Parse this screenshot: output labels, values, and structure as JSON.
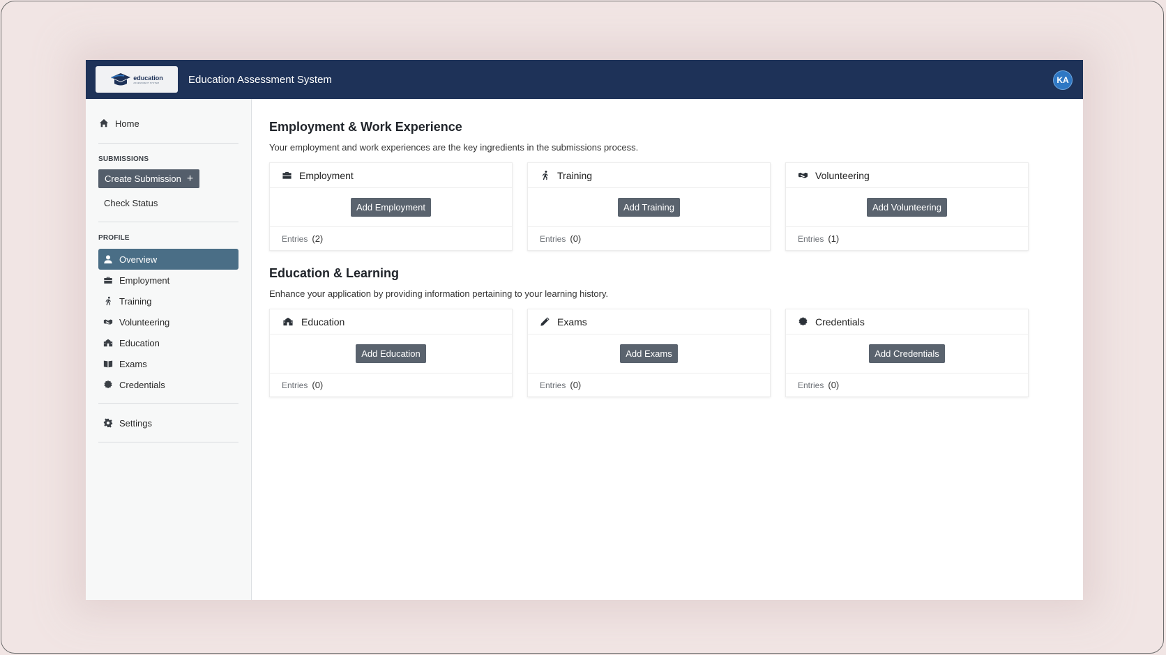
{
  "header": {
    "logo_word": "education",
    "logo_sub": "ASSESSMENT SYSTEM",
    "title": "Education Assessment System",
    "avatar_initials": "KA"
  },
  "sidebar": {
    "home": "Home",
    "submissions_label": "SUBMISSIONS",
    "create_submission": "Create Submission",
    "check_status": "Check Status",
    "profile_label": "PROFILE",
    "items": [
      {
        "label": "Overview",
        "icon": "user-icon"
      },
      {
        "label": "Employment",
        "icon": "briefcase-icon"
      },
      {
        "label": "Training",
        "icon": "running-icon"
      },
      {
        "label": "Volunteering",
        "icon": "handshake-icon"
      },
      {
        "label": "Education",
        "icon": "school-icon"
      },
      {
        "label": "Exams",
        "icon": "book-icon"
      },
      {
        "label": "Credentials",
        "icon": "badge-icon"
      }
    ],
    "settings": "Settings"
  },
  "sections": [
    {
      "title": "Employment & Work Experience",
      "description": "Your employment and work experiences are the key ingredients in the submissions process.",
      "cards": [
        {
          "title": "Employment",
          "button": "Add Employment",
          "entries_label": "Entries",
          "count": "(2)"
        },
        {
          "title": "Training",
          "button": "Add Training",
          "entries_label": "Entries",
          "count": "(0)"
        },
        {
          "title": "Volunteering",
          "button": "Add Volunteering",
          "entries_label": "Entries",
          "count": "(1)"
        }
      ]
    },
    {
      "title": "Education & Learning",
      "description": "Enhance your application by providing information pertaining to your learning history.",
      "cards": [
        {
          "title": "Education",
          "button": "Add Education",
          "entries_label": "Entries",
          "count": "(0)"
        },
        {
          "title": "Exams",
          "button": "Add Exams",
          "entries_label": "Entries",
          "count": "(0)"
        },
        {
          "title": "Credentials",
          "button": "Add Credentials",
          "entries_label": "Entries",
          "count": "(0)"
        }
      ]
    }
  ],
  "colors": {
    "topbar": "#1e3258",
    "active_nav": "#4a6e86",
    "button": "#5a636e",
    "avatar": "#2f78c4"
  }
}
